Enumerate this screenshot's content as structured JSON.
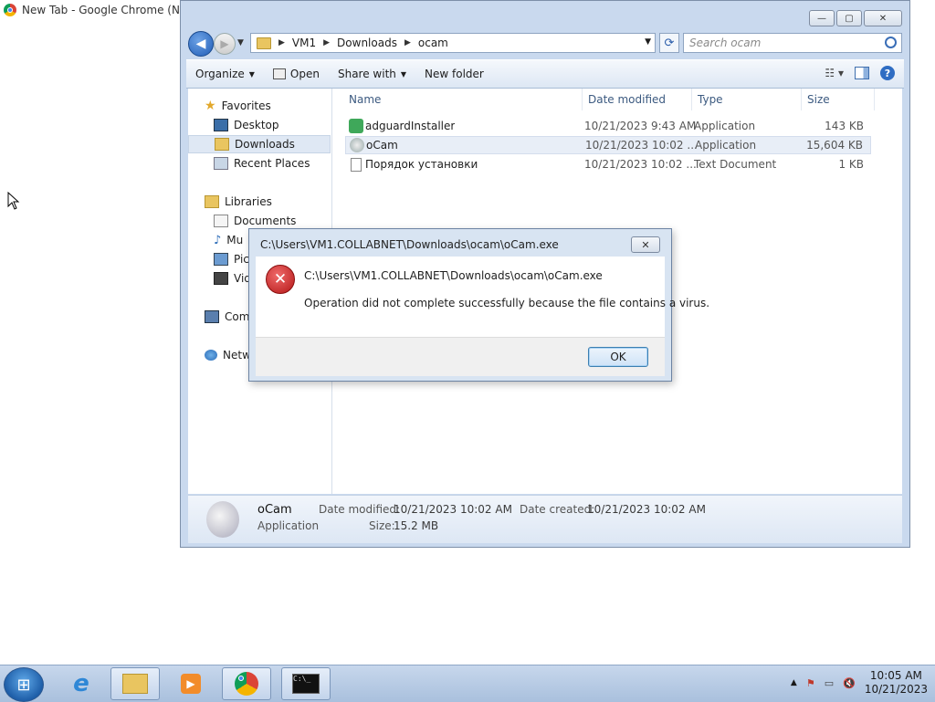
{
  "chrome": {
    "title": "New Tab - Google Chrome (Not"
  },
  "explorer": {
    "window_buttons": {
      "minimize": "—",
      "maximize": "▢",
      "close": "✕"
    },
    "breadcrumb": [
      "VM1",
      "Downloads",
      "ocam"
    ],
    "search_placeholder": "Search ocam",
    "toolbar": {
      "organize": "Organize",
      "open": "Open",
      "share_with": "Share with",
      "new_folder": "New folder"
    },
    "nav": {
      "favorites": "Favorites",
      "desktop": "Desktop",
      "downloads": "Downloads",
      "recent_places": "Recent Places",
      "libraries": "Libraries",
      "documents": "Documents",
      "music": "Mu",
      "pictures": "Pic",
      "videos": "Vid",
      "computer": "Com",
      "network": "Netw"
    },
    "columns": {
      "name": "Name",
      "date": "Date modified",
      "type": "Type",
      "size": "Size"
    },
    "files": [
      {
        "name": "adguardInstaller",
        "date": "10/21/2023 9:43 AM",
        "type": "Application",
        "size": "143 KB"
      },
      {
        "name": "oCam",
        "date": "10/21/2023 10:02 ...",
        "type": "Application",
        "size": "15,604 KB"
      },
      {
        "name": "Порядок установки",
        "date": "10/21/2023 10:02 ...",
        "type": "Text Document",
        "size": "1 KB"
      }
    ],
    "details": {
      "name": "oCam",
      "kind": "Application",
      "date_modified_label": "Date modified:",
      "date_modified": "10/21/2023 10:02 AM",
      "date_created_label": "Date created:",
      "date_created": "10/21/2023 10:02 AM",
      "size_label": "Size:",
      "size": "15.2 MB"
    }
  },
  "dialog": {
    "title": "C:\\Users\\VM1.COLLABNET\\Downloads\\ocam\\oCam.exe",
    "path": "C:\\Users\\VM1.COLLABNET\\Downloads\\ocam\\oCam.exe",
    "message": "Operation did not complete successfully because the file contains a virus.",
    "ok": "OK",
    "close": "✕"
  },
  "taskbar": {
    "time": "10:05 AM",
    "date": "10/21/2023"
  }
}
